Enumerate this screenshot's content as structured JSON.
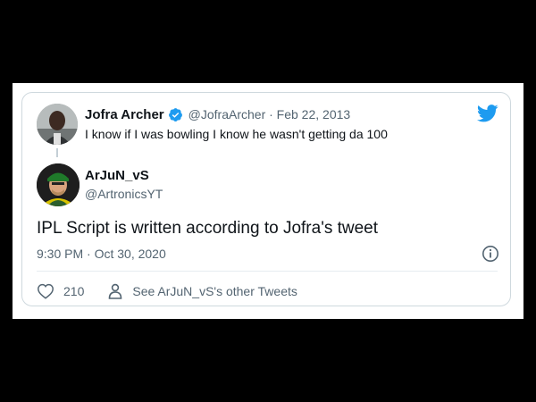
{
  "quoted": {
    "name": "Jofra Archer",
    "meta": "@JofraArcher · Feb 22, 2013",
    "text": "I know if I was bowling I know he wasn't getting da 100"
  },
  "tweet": {
    "name": "ArJuN_vS",
    "handle": "@ArtronicsYT",
    "text": "IPL Script is written according to Jofra's tweet",
    "timestamp": "9:30 PM · Oct 30, 2020",
    "likes": "210",
    "other_tweets_link": "See ArJuN_vS's other Tweets"
  },
  "colors": {
    "accent": "#1d9bf0",
    "text_primary": "#0f1419",
    "text_secondary": "#536471",
    "border": "#cfd9de"
  },
  "icons": {
    "verified": "verified-badge-icon",
    "brand": "twitter-bird-icon",
    "info": "info-icon",
    "like": "heart-icon",
    "profile": "person-icon"
  }
}
